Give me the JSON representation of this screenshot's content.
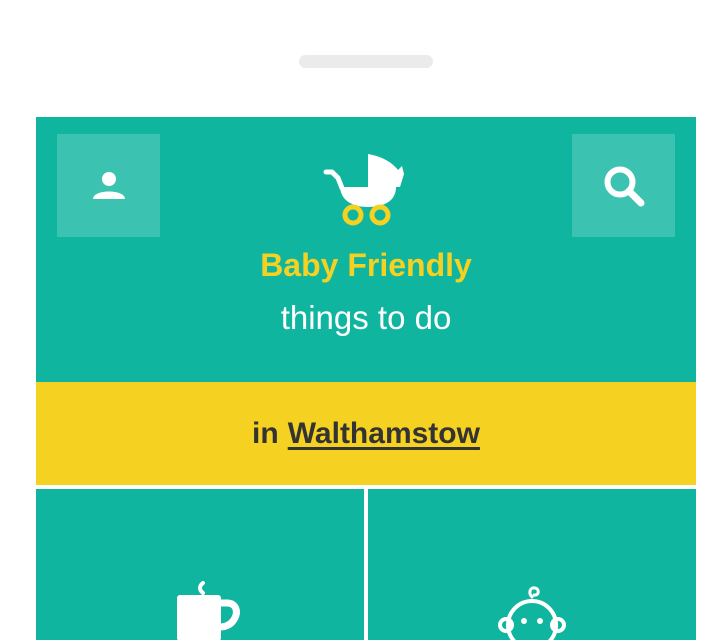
{
  "app": {
    "brand": "Baby Friendly",
    "tagline": "things to do"
  },
  "location": {
    "prefix": "in",
    "name": "Walthamstow"
  },
  "header": {
    "left_button_icon": "user-icon",
    "right_button_icon": "search-icon",
    "logo_icon": "pram-icon"
  },
  "tiles": [
    {
      "icon": "coffee-cup-icon"
    },
    {
      "icon": "baby-face-icon"
    }
  ],
  "colors": {
    "primary": "#10b5a0",
    "accent": "#f5d122",
    "text_dark": "#333333",
    "text_light": "#ffffff"
  }
}
